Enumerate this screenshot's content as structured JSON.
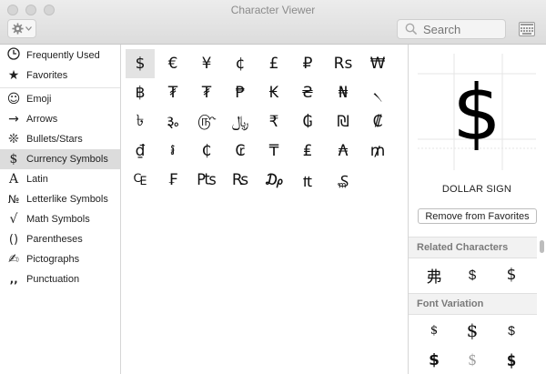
{
  "window": {
    "title": "Character Viewer"
  },
  "toolbar": {
    "search_placeholder": "Search"
  },
  "icons": {
    "gear": "gear-icon",
    "search": "magnifier-icon",
    "keyboard": "keyboard-icon"
  },
  "sidebar": {
    "items": [
      {
        "label": "Frequently Used",
        "icon": "🕘"
      },
      {
        "label": "Favorites",
        "icon": "★"
      },
      {
        "label": "Emoji",
        "icon": "☺"
      },
      {
        "label": "Arrows",
        "icon": "→"
      },
      {
        "label": "Bullets/Stars",
        "icon": "❊"
      },
      {
        "label": "Currency Symbols",
        "icon": "$"
      },
      {
        "label": "Latin",
        "icon": "A"
      },
      {
        "label": "Letterlike Symbols",
        "icon": "№"
      },
      {
        "label": "Math Symbols",
        "icon": "√"
      },
      {
        "label": "Parentheses",
        "icon": "()"
      },
      {
        "label": "Pictographs",
        "icon": "✍"
      },
      {
        "label": "Punctuation",
        "icon": "‚‚"
      }
    ],
    "selected": "Currency Symbols"
  },
  "grid": {
    "rows": [
      [
        "$",
        "€",
        "¥",
        "¢",
        "£",
        "₽",
        "Rs",
        "₩"
      ],
      [
        "฿",
        "₮",
        "₮",
        "₱",
        "₭",
        "₴",
        "₦",
        "৲"
      ],
      [
        "৳",
        "૱",
        "௹",
        "﷼",
        "₹",
        "₲",
        "₪",
        "₡"
      ],
      [
        "₫",
        "៛",
        "₵",
        "₢",
        "₸",
        "₤",
        "₳",
        "₥"
      ],
      [
        "₠",
        "₣",
        "₧",
        "₨",
        "₯",
        "₶",
        "₷"
      ]
    ],
    "selected": "$"
  },
  "detail": {
    "glyph": "$",
    "name": "DOLLAR SIGN",
    "remove_label": "Remove from Favorites",
    "related_header": "Related Characters",
    "related": [
      "弗",
      "$",
      "$"
    ],
    "font_variation_header": "Font Variation",
    "font_variation": [
      "$",
      "$",
      "$",
      "$",
      "$",
      "$"
    ]
  }
}
